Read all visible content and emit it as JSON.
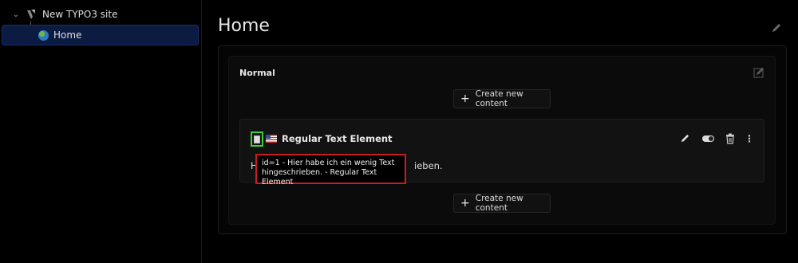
{
  "tree": {
    "root_label": "New TYPO3 site",
    "home_label": "Home"
  },
  "main": {
    "page_title": "Home",
    "column": {
      "title": "Normal",
      "create_label": "Create new content",
      "element": {
        "title": "Regular Text Element",
        "bodytext_start": "H",
        "bodytext_end": "ieben.",
        "tooltip_line1": "id=1 - Hier habe ich ein wenig Text",
        "tooltip_line2": "hingeschrieben. - Regular Text Element"
      }
    }
  },
  "icons": {
    "tree_chevron": "chevron-down-icon",
    "site": "typo3-icon",
    "page": "globe-icon",
    "edit": "pencil-icon",
    "toggle": "toggle-icon",
    "delete": "trash-icon",
    "more": "more-vertical-icon",
    "type": "text-element-icon",
    "flag": "us-flag-icon"
  },
  "colors": {
    "selection_bg": "#0b1b42",
    "highlight_green": "#3ad13a",
    "highlight_red": "#c81e1e"
  }
}
